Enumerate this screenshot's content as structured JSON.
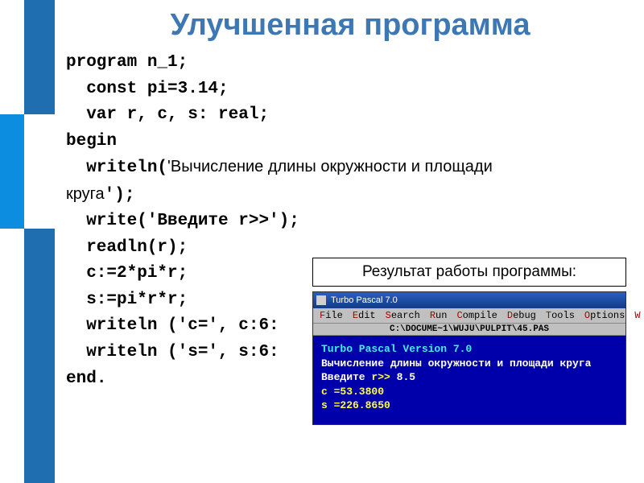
{
  "title": "Улучшенная программа",
  "code": {
    "l1a": "program",
    "l1b": " n_1;",
    "l2a": "  const",
    "l2b": " pi=3.14;",
    "l3a": "  var",
    "l3b": " r, c, s: real;",
    "l4": "begin",
    "l5a": "  writeln(",
    "l5b": "'Вычисление длины окружности и площади",
    "l6a": "круга",
    "l6b": "');",
    "l7": "  write('Введите r>>');",
    "l8": "  readln(r);",
    "l9": "  c:=2*pi*r;",
    "l10": "  s:=pi*r*r;",
    "l11": "  writeln ('c=', c:6:",
    "l12": "  writeln ('s=', s:6:",
    "l13a": "end",
    "l13b": "."
  },
  "result_label": "Результат работы программы:",
  "tp": {
    "titlebar": "Turbo Pascal 7.0",
    "menu": [
      "File",
      "Edit",
      "Search",
      "Run",
      "Compile",
      "Debug",
      "Tools",
      "Options",
      "W"
    ],
    "path": "C:\\DOCUME~1\\WUJU\\PULPIT\\45.PAS",
    "line1a": "Turbo Pascal   Version 7.0",
    "line2": "Вычисление длины окружности и площади круга",
    "line3a": "Введите ",
    "line3b": "r>> ",
    "line3c": "8.5",
    "line4": "c  =53.3800",
    "line5": "s  =226.8650"
  }
}
